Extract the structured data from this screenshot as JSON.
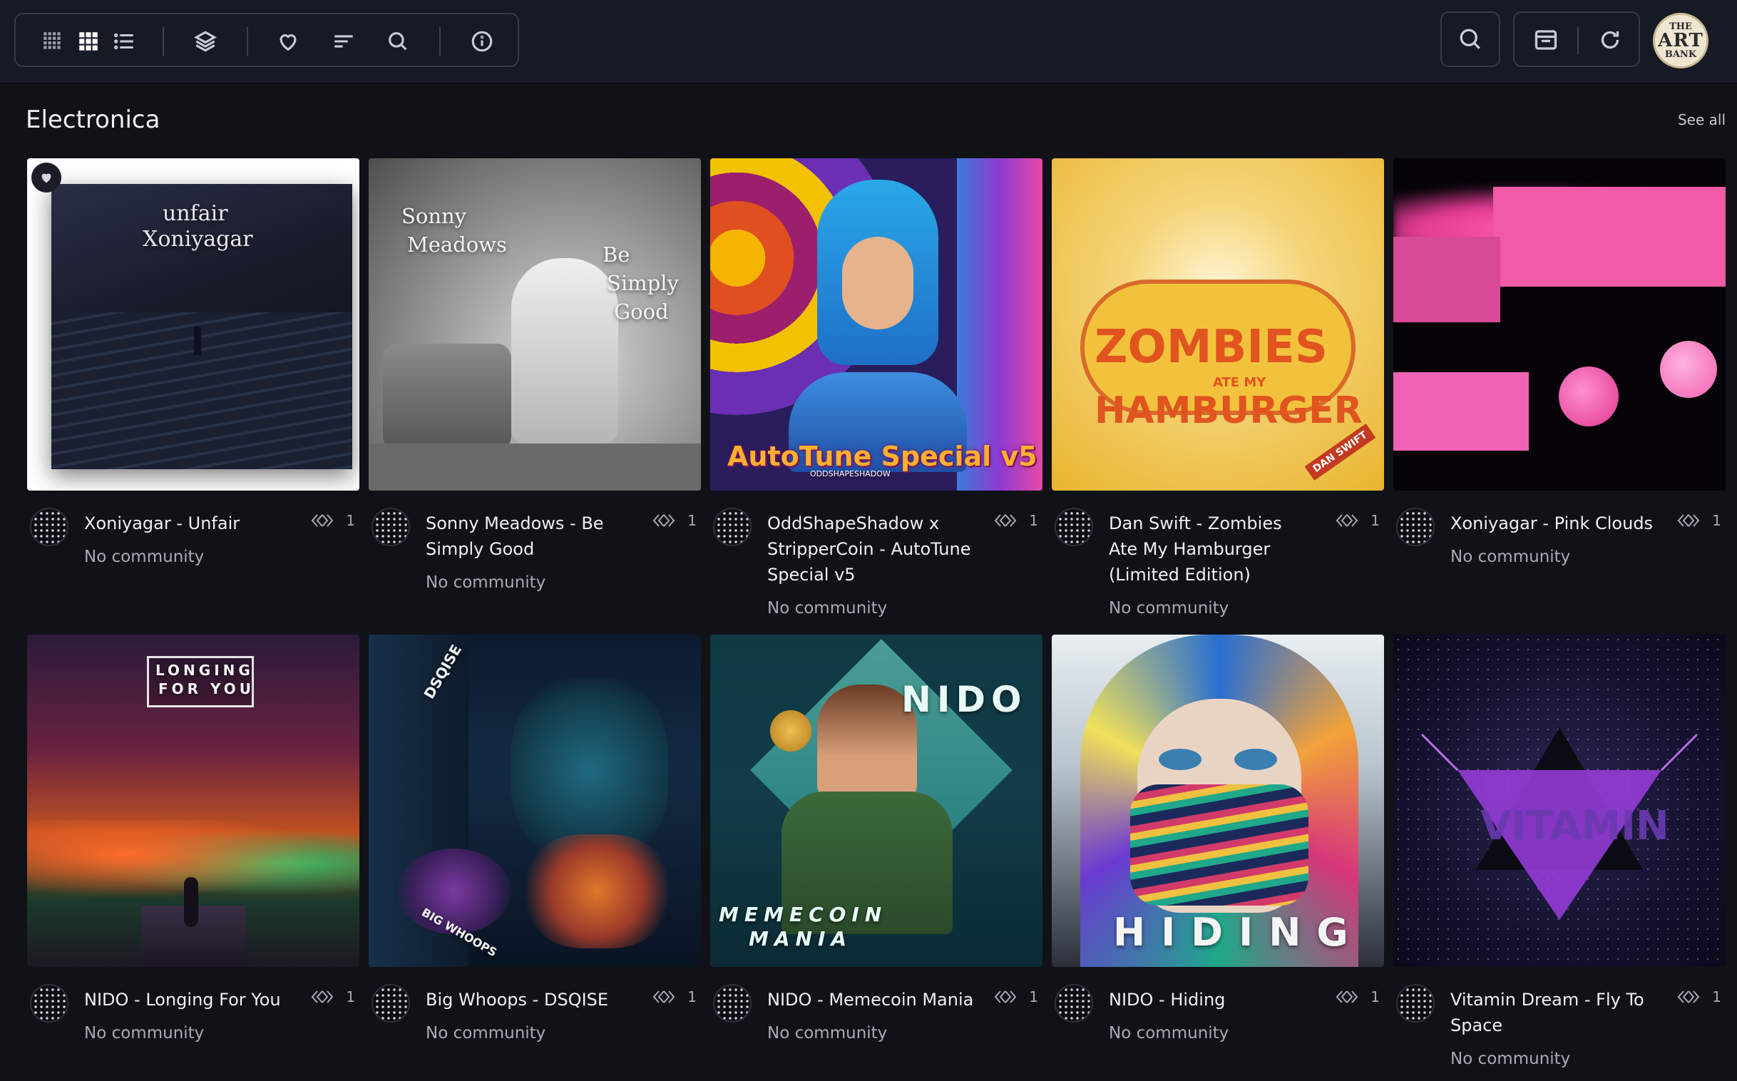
{
  "toolbar": {
    "left_icons": [
      "grid-small-icon",
      "grid-large-icon",
      "list-icon",
      "layers-icon",
      "heart-icon",
      "sort-icon",
      "search-icon",
      "info-icon"
    ],
    "right_icons": [
      "search-icon",
      "inbox-icon",
      "refresh-icon"
    ],
    "avatar": {
      "line1": "THE",
      "line2": "ART",
      "line3": "BANK"
    }
  },
  "section": {
    "title": "Electronica",
    "see_all": "See all"
  },
  "cards": [
    {
      "name": "Xoniyagar - Unfair",
      "community": "No community",
      "editions": "1",
      "art_text": [
        "unfair",
        "Xoniyagar"
      ]
    },
    {
      "name": "Sonny Meadows - Be Simply Good",
      "community": "No community",
      "editions": "1",
      "art_text": [
        "Sonny",
        "Meadows",
        "Be",
        "Simply",
        "Good"
      ]
    },
    {
      "name": "OddShapeShadow x StripperCoin - AutoTune Special v5",
      "community": "No community",
      "editions": "1",
      "art_text": [
        "AutoTune Special v5",
        "ODDSHAPESHADOW"
      ]
    },
    {
      "name": "Dan Swift - Zombies Ate My Hamburger (Limited Edition)",
      "community": "No community",
      "editions": "1",
      "art_text": [
        "ZOMBIES",
        "ATE MY",
        "HAMBURGER",
        "DAN SWIFT"
      ]
    },
    {
      "name": "Xoniyagar - Pink Clouds",
      "community": "No community",
      "editions": "1",
      "art_text": []
    },
    {
      "name": "NIDO - Longing For You",
      "community": "No community",
      "editions": "1",
      "art_text": [
        "LONGING",
        "FOR YOU"
      ]
    },
    {
      "name": "Big Whoops - DSQISE",
      "community": "No community",
      "editions": "1",
      "art_text": [
        "DSQISE",
        "BIG WHOOPS"
      ]
    },
    {
      "name": "NIDO - Memecoin Mania",
      "community": "No community",
      "editions": "1",
      "art_text": [
        "NIDO",
        "MEMECOIN",
        "MANIA"
      ]
    },
    {
      "name": "NIDO - Hiding",
      "community": "No community",
      "editions": "1",
      "art_text": [
        "HIDING"
      ]
    },
    {
      "name": "Vitamin Dream - Fly To Space",
      "community": "No community",
      "editions": "1",
      "art_text": [
        "VITAMIN"
      ]
    }
  ]
}
